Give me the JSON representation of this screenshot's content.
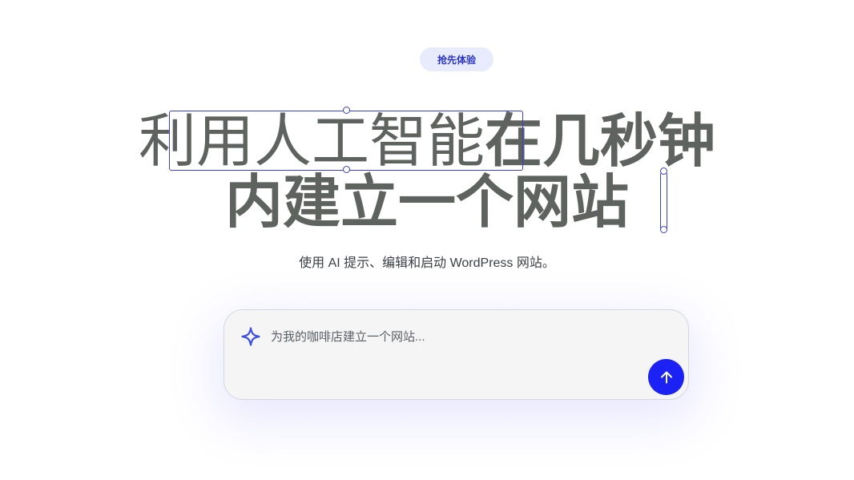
{
  "badge": {
    "label": "抢先体验"
  },
  "headline": {
    "line1_selected": "利用人工智能",
    "line1_rest": "在几秒钟",
    "line2": "内建立一个网站"
  },
  "subtitle": "使用 AI 提示、编辑和启动 WordPress 网站。",
  "prompt": {
    "placeholder": "为我的咖啡店建立一个网站...",
    "value": "",
    "icon": "sparkle-icon",
    "send_icon": "arrow-up-icon"
  },
  "colors": {
    "accent": "#1d22f4",
    "badge_bg": "#e8ebfb",
    "badge_text": "#2b34c9",
    "headline": "#5f6360",
    "selection": "#3a3fd0"
  }
}
